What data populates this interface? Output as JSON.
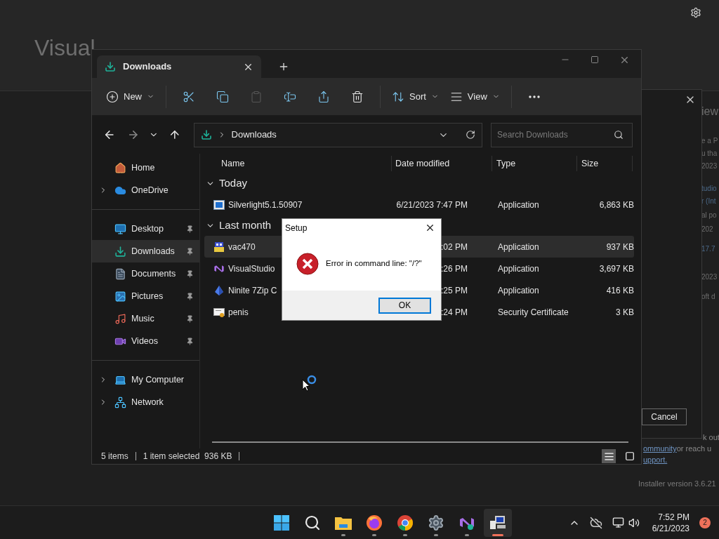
{
  "installer": {
    "title": "Visual",
    "fragments": [
      {
        "text": "iew",
        "kind": "heading"
      },
      {
        "text": "e a P",
        "kind": "text"
      },
      {
        "text": "u tha",
        "kind": "text"
      },
      {
        "text": "2023",
        "kind": "text"
      },
      {
        "text": "tudio",
        "kind": "link"
      },
      {
        "text": "r (Int",
        "kind": "link"
      },
      {
        "text": "al po",
        "kind": "text"
      },
      {
        "text": "202",
        "kind": "text"
      },
      {
        "text": "17.7",
        "kind": "link"
      },
      {
        "text": "2023",
        "kind": "text"
      },
      {
        "text": "oft d",
        "kind": "text"
      }
    ],
    "footer": [
      {
        "text": "k out"
      },
      {
        "link": "ommunity",
        "text": " or reach u"
      },
      {
        "link": "upport."
      }
    ],
    "version": "Installer version 3.6.21",
    "dialog": {
      "button": "Cancel"
    }
  },
  "explorer": {
    "tabs": [
      {
        "label": "Downloads",
        "selected": true
      }
    ],
    "toolbar": [
      {
        "kind": "new",
        "label": "New",
        "disabled": false
      },
      {
        "kind": "cut",
        "disabled": false
      },
      {
        "kind": "copy",
        "disabled": false
      },
      {
        "kind": "paste",
        "disabled": true
      },
      {
        "kind": "rename",
        "disabled": false
      },
      {
        "kind": "share",
        "disabled": false
      },
      {
        "kind": "delete",
        "disabled": false
      },
      {
        "kind": "sort",
        "label": "Sort",
        "disabled": false
      },
      {
        "kind": "view",
        "label": "View",
        "disabled": false
      },
      {
        "kind": "more",
        "disabled": false
      }
    ],
    "address": {
      "path": "Downloads"
    },
    "search": {
      "placeholder": "Search Downloads"
    },
    "sidebar": [
      {
        "kind": "home",
        "label": "Home",
        "selected": false
      },
      {
        "kind": "cloud",
        "label": "OneDrive",
        "expandable": true,
        "selected": false
      },
      {
        "kind": "divider"
      },
      {
        "kind": "desktop",
        "label": "Desktop",
        "pinned": true,
        "selected": false
      },
      {
        "kind": "downloads",
        "label": "Downloads",
        "pinned": true,
        "selected": true
      },
      {
        "kind": "documents",
        "label": "Documents",
        "pinned": true,
        "selected": false
      },
      {
        "kind": "pictures",
        "label": "Pictures",
        "pinned": true,
        "selected": false
      },
      {
        "kind": "music",
        "label": "Music",
        "pinned": true,
        "selected": false
      },
      {
        "kind": "videos",
        "label": "Videos",
        "pinned": true,
        "selected": false
      },
      {
        "kind": "divider"
      },
      {
        "kind": "computer",
        "label": "My Computer",
        "expandable": true,
        "selected": false
      },
      {
        "kind": "network",
        "label": "Network",
        "expandable": true,
        "selected": false
      }
    ],
    "columns": [
      "Name",
      "Date modified",
      "Type",
      "Size"
    ],
    "groups": [
      {
        "label": "Today",
        "expanded": true,
        "rows": [
          {
            "kind": "silverlight",
            "name": "Silverlight5.1.50907",
            "date": "6/21/2023 7:47 PM",
            "type": "Application",
            "size": "6,863 KB",
            "selected": false
          }
        ]
      },
      {
        "label": "Last month",
        "expanded": true,
        "rows": [
          {
            "kind": "package",
            "name": "vac470",
            "date": ":02 PM",
            "type": "Application",
            "size": "937 KB",
            "selected": true
          },
          {
            "kind": "vs",
            "name": "VisualStudio",
            "date": ":26 PM",
            "type": "Application",
            "size": "3,697 KB",
            "selected": false
          },
          {
            "kind": "ninite",
            "name": "Ninite 7Zip C",
            "date": ":25 PM",
            "type": "Application",
            "size": "416 KB",
            "selected": false
          },
          {
            "kind": "certificate",
            "name": "penis",
            "date": ":24 PM",
            "type": "Security Certificate",
            "size": "3 KB",
            "selected": false
          }
        ]
      }
    ],
    "status": {
      "count": "5 items",
      "selection": "1 item selected  936 KB"
    },
    "views": [
      {
        "kind": "details",
        "selected": true
      },
      {
        "kind": "tiles",
        "selected": false
      }
    ]
  },
  "setup_dialog": {
    "title": "Setup",
    "message": "Error in command line: \"/?\"",
    "button": "OK"
  },
  "taskbar": {
    "apps": [
      {
        "kind": "start",
        "running": false,
        "active": false
      },
      {
        "kind": "search",
        "running": false,
        "active": false
      },
      {
        "kind": "explorer",
        "running": true,
        "active": false
      },
      {
        "kind": "firefox",
        "running": true,
        "active": false
      },
      {
        "kind": "chrome",
        "running": true,
        "active": false
      },
      {
        "kind": "settings",
        "running": true,
        "active": false
      },
      {
        "kind": "vs",
        "running": true,
        "active": false
      },
      {
        "kind": "setup",
        "running": true,
        "active": true
      }
    ],
    "time": "7:52 PM",
    "date": "6/21/2023",
    "notifications": "2"
  }
}
